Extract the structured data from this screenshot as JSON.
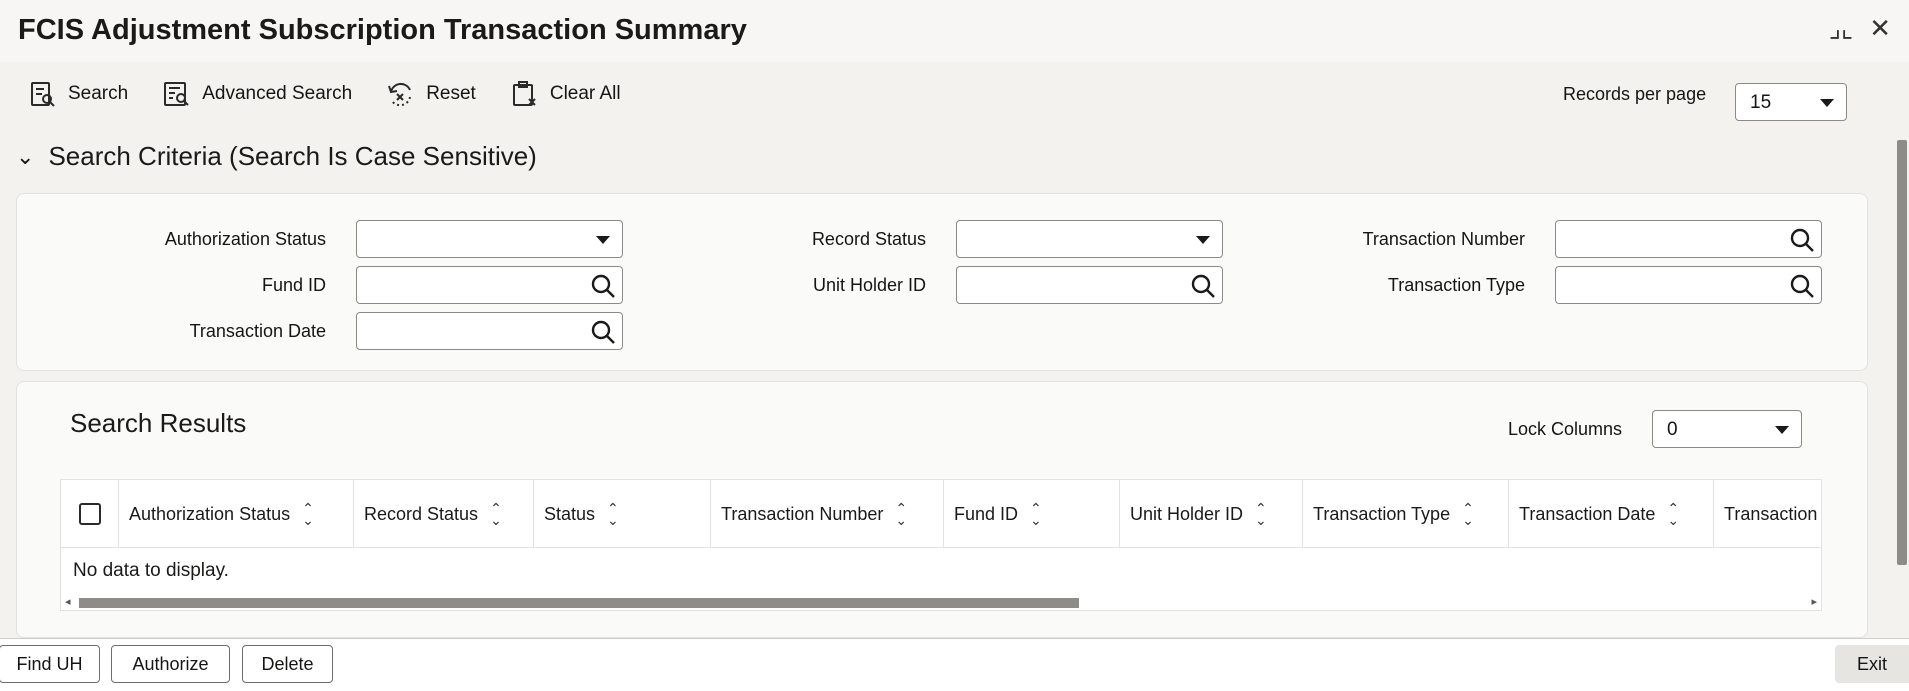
{
  "window": {
    "title": "FCIS Adjustment Subscription Transaction Summary",
    "icons": [
      "collapse-icon",
      "close-icon"
    ]
  },
  "toolbar": {
    "search": "Search",
    "advanced_search": "Advanced Search",
    "reset": "Reset",
    "clear_all": "Clear All"
  },
  "records_per_page": {
    "label": "Records per page",
    "value": "15"
  },
  "criteria": {
    "header": "Search Criteria (Search Is Case Sensitive)",
    "fields": {
      "authorization_status": {
        "label": "Authorization Status",
        "value": ""
      },
      "record_status": {
        "label": "Record Status",
        "value": ""
      },
      "transaction_number": {
        "label": "Transaction Number",
        "value": ""
      },
      "fund_id": {
        "label": "Fund ID",
        "value": ""
      },
      "unit_holder_id": {
        "label": "Unit Holder ID",
        "value": ""
      },
      "transaction_type": {
        "label": "Transaction Type",
        "value": ""
      },
      "transaction_date": {
        "label": "Transaction Date",
        "value": ""
      }
    }
  },
  "results": {
    "title": "Search Results",
    "lock_columns": {
      "label": "Lock Columns",
      "value": "0"
    },
    "columns": [
      "Authorization Status",
      "Record Status",
      "Status",
      "Transaction Number",
      "Fund ID",
      "Unit Holder ID",
      "Transaction Type",
      "Transaction Date",
      "Transaction"
    ],
    "empty_message": "No data to display."
  },
  "footer": {
    "find_uh": "Find UH",
    "authorize": "Authorize",
    "delete": "Delete",
    "exit": "Exit"
  }
}
